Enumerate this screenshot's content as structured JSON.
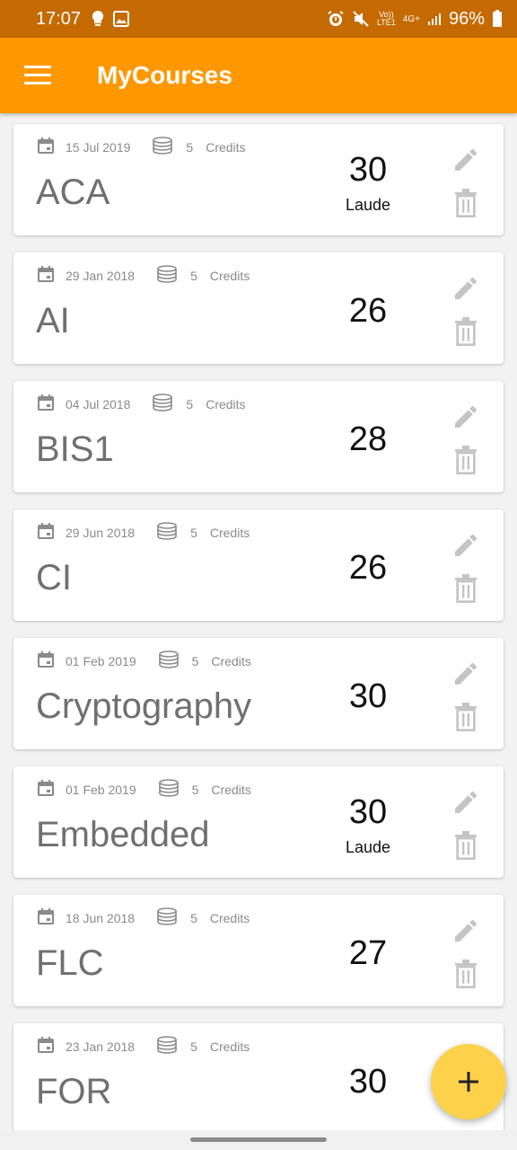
{
  "status_bar": {
    "time": "17:07",
    "left_icons": [
      "location-bulb-icon",
      "image-icon"
    ],
    "right_icons": [
      "alarm-icon",
      "mute-icon",
      "volte-icon",
      "4g-icon",
      "signal-icon"
    ],
    "volte_top": "Vo))",
    "volte_bottom": "LTE1",
    "net_label": "4G+",
    "battery": "96%"
  },
  "app_bar": {
    "title": "MyCourses",
    "menu_icon": "hamburger-menu-icon"
  },
  "colors": {
    "primary": "#ff9800",
    "status_bar": "#c46a00",
    "fab": "#fdd14a",
    "icon_grey": "#9e9e9e",
    "name_grey": "#707070"
  },
  "credits_label": "Credits",
  "courses": [
    {
      "date": "15 Jul 2019",
      "credits": "5",
      "name": "ACA",
      "grade": "30",
      "laude": "Laude"
    },
    {
      "date": "29 Jan 2018",
      "credits": "5",
      "name": "AI",
      "grade": "26",
      "laude": ""
    },
    {
      "date": "04 Jul 2018",
      "credits": "5",
      "name": "BIS1",
      "grade": "28",
      "laude": ""
    },
    {
      "date": "29 Jun 2018",
      "credits": "5",
      "name": "CI",
      "grade": "26",
      "laude": ""
    },
    {
      "date": "01 Feb 2019",
      "credits": "5",
      "name": "Cryptography",
      "grade": "30",
      "laude": ""
    },
    {
      "date": "01 Feb 2019",
      "credits": "5",
      "name": "Embedded",
      "grade": "30",
      "laude": "Laude"
    },
    {
      "date": "18 Jun 2018",
      "credits": "5",
      "name": "FLC",
      "grade": "27",
      "laude": ""
    },
    {
      "date": "23 Jan 2018",
      "credits": "5",
      "name": "FOR",
      "grade": "30",
      "laude": ""
    }
  ],
  "fab": {
    "label": "+",
    "icon": "add-icon"
  }
}
